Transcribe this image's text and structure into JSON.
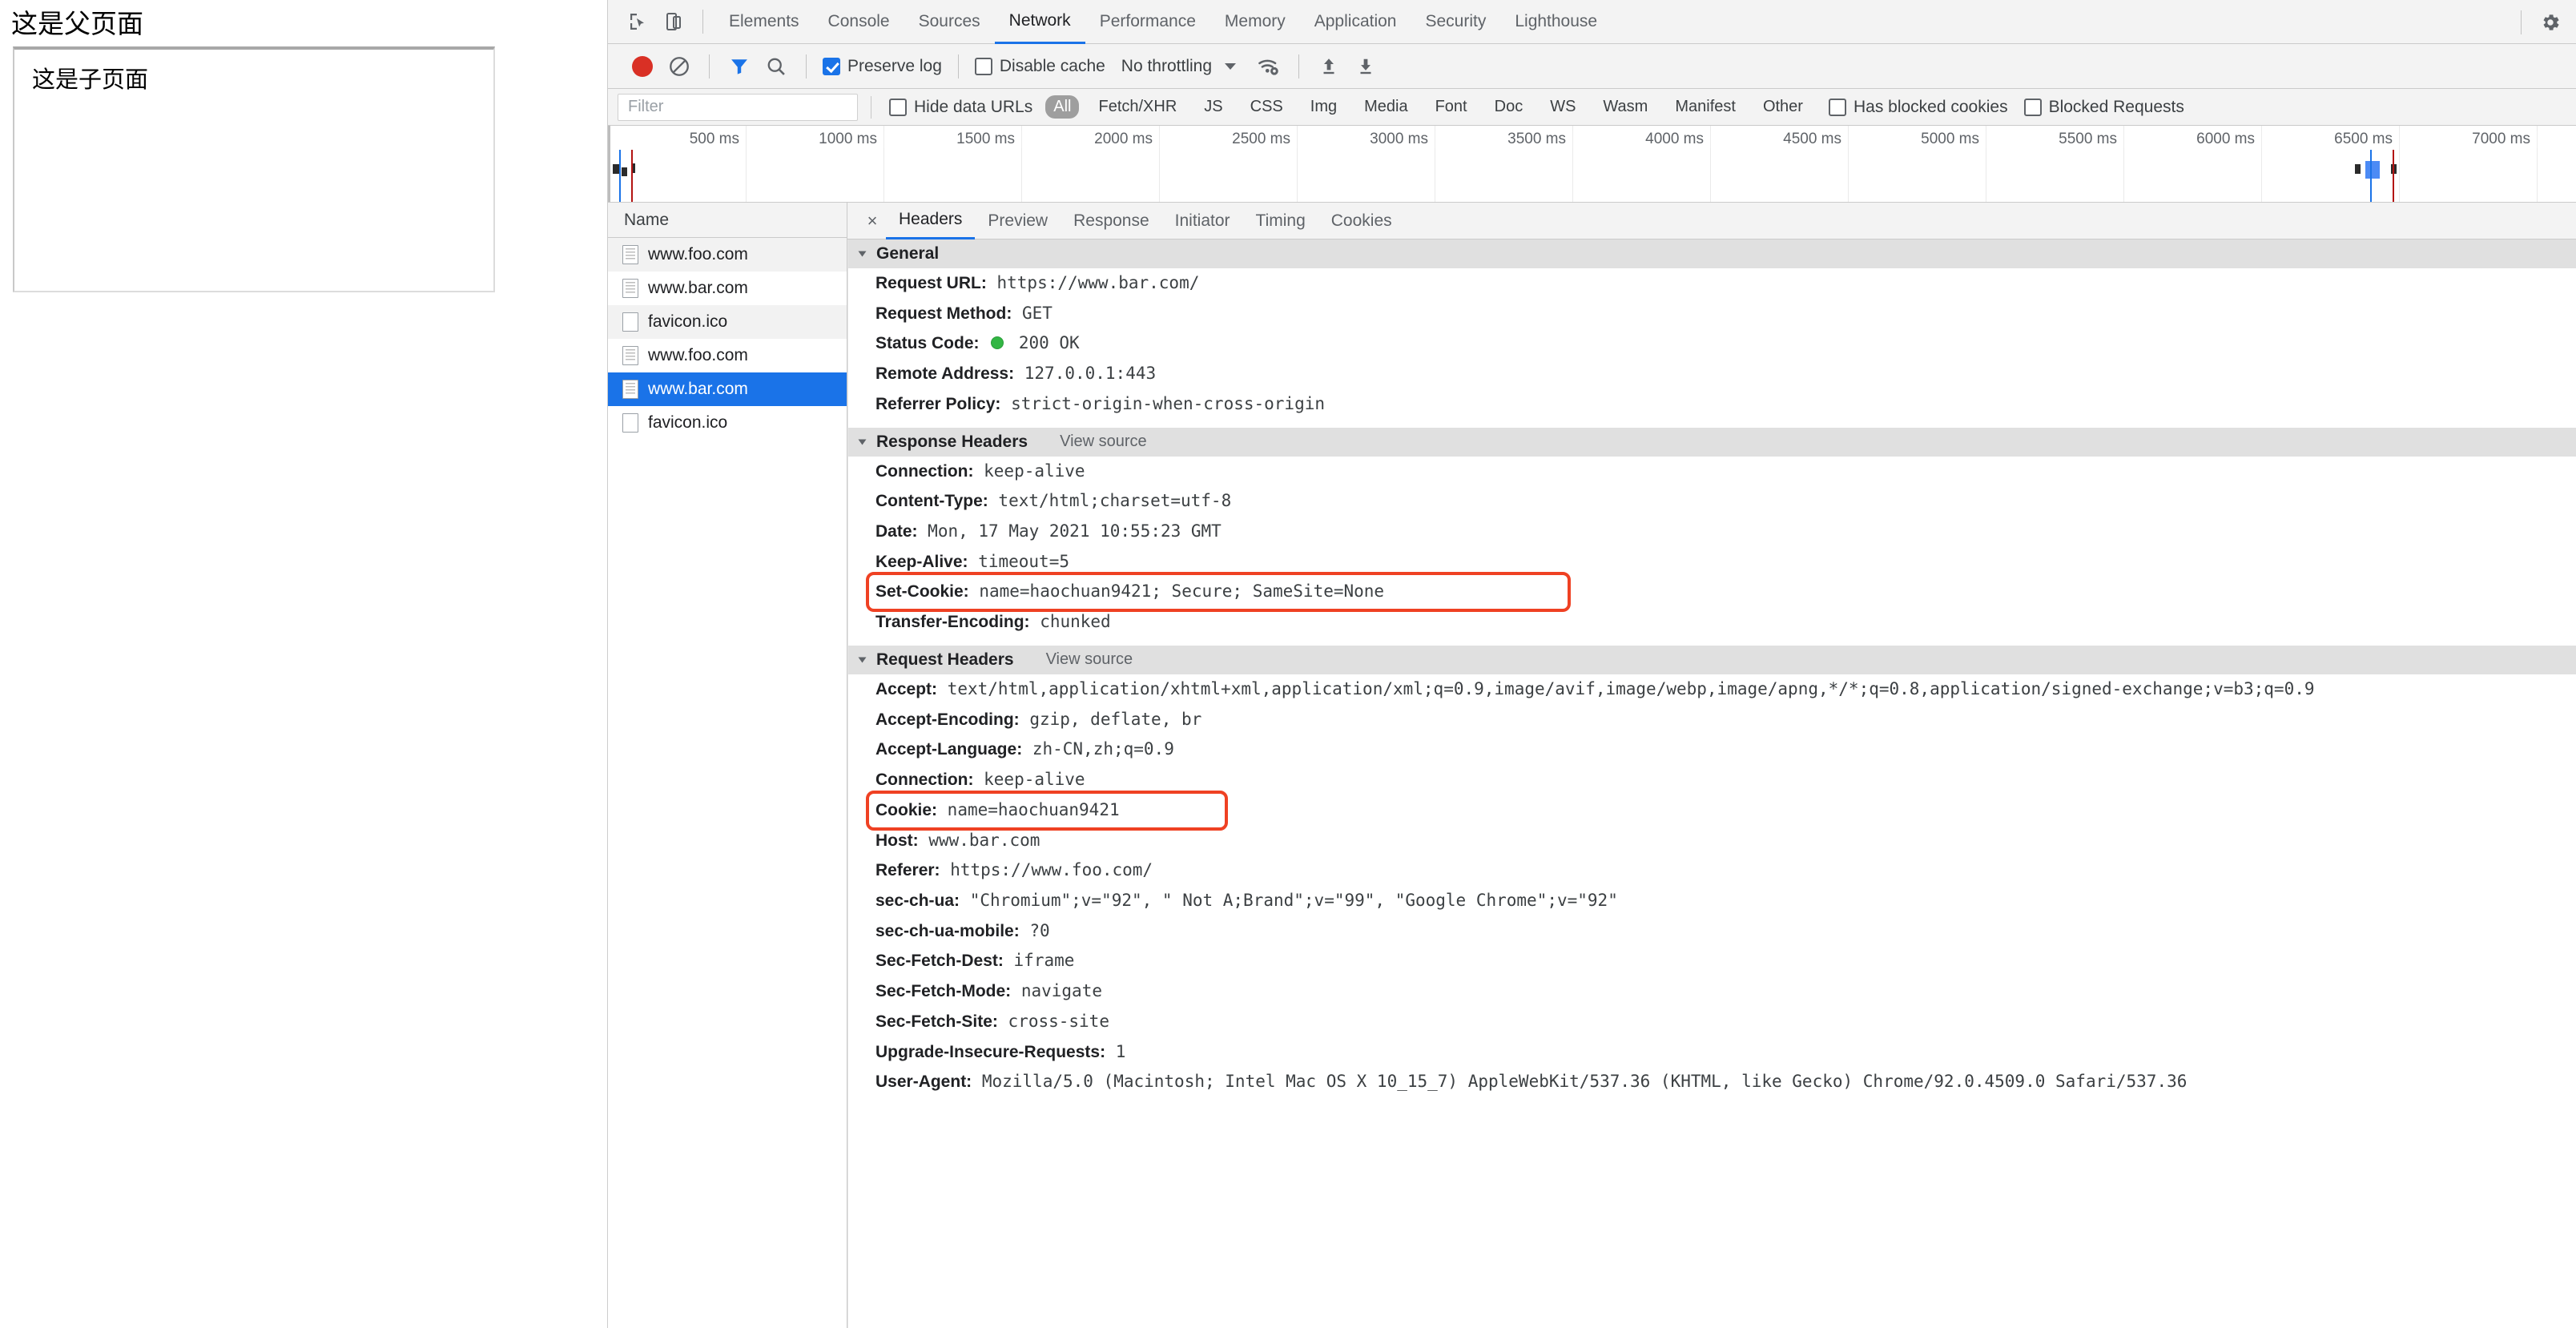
{
  "page": {
    "parent_title": "这是父页面",
    "iframe_title": "这是子页面"
  },
  "devtools": {
    "tabs": [
      {
        "label": "Elements",
        "active": false
      },
      {
        "label": "Console",
        "active": false
      },
      {
        "label": "Sources",
        "active": false
      },
      {
        "label": "Network",
        "active": true
      },
      {
        "label": "Performance",
        "active": false
      },
      {
        "label": "Memory",
        "active": false
      },
      {
        "label": "Application",
        "active": false
      },
      {
        "label": "Security",
        "active": false
      },
      {
        "label": "Lighthouse",
        "active": false
      }
    ],
    "toolbar": {
      "record_icon": "record-circle-icon",
      "clear_icon": "clear-icon",
      "filter_icon": "funnel-icon",
      "search_icon": "search-icon",
      "preserve_log_label": "Preserve log",
      "preserve_log_checked": true,
      "disable_cache_label": "Disable cache",
      "disable_cache_checked": false,
      "throttling_value": "No throttling",
      "wifi_icon": "wifi-settings-icon",
      "import_icon": "import-har-icon",
      "export_icon": "export-har-icon",
      "settings_icon": "gear-icon"
    },
    "filterbar": {
      "filter_placeholder": "Filter",
      "hide_data_urls_label": "Hide data URLs",
      "hide_data_urls_checked": false,
      "types": [
        "All",
        "Fetch/XHR",
        "JS",
        "CSS",
        "Img",
        "Media",
        "Font",
        "Doc",
        "WS",
        "Wasm",
        "Manifest",
        "Other"
      ],
      "selected_type": "All",
      "has_blocked_cookies_label": "Has blocked cookies",
      "has_blocked_cookies_checked": false,
      "blocked_requests_label": "Blocked Requests",
      "blocked_requests_checked": false
    },
    "overview": {
      "tick_labels": [
        "500 ms",
        "1000 ms",
        "1500 ms",
        "2000 ms",
        "2500 ms",
        "3000 ms",
        "3500 ms",
        "4000 ms",
        "4500 ms",
        "5000 ms",
        "5500 ms",
        "6000 ms",
        "6500 ms",
        "7000 ms"
      ],
      "dom_content_loaded_color": "#1a73e8",
      "load_color": "#b31412",
      "selected_bar_color": "#4285f4"
    },
    "requests": {
      "column_header": "Name",
      "rows": [
        {
          "name": "www.foo.com",
          "icon": "document-icon",
          "selected": false
        },
        {
          "name": "www.bar.com",
          "icon": "document-icon",
          "selected": false
        },
        {
          "name": "favicon.ico",
          "icon": "blank-document-icon",
          "selected": false
        },
        {
          "name": "www.foo.com",
          "icon": "document-icon",
          "selected": false
        },
        {
          "name": "www.bar.com",
          "icon": "document-icon",
          "selected": true
        },
        {
          "name": "favicon.ico",
          "icon": "blank-document-icon",
          "selected": false
        }
      ]
    },
    "detail": {
      "close_label": "×",
      "tabs": [
        {
          "label": "Headers",
          "active": true
        },
        {
          "label": "Preview",
          "active": false
        },
        {
          "label": "Response",
          "active": false
        },
        {
          "label": "Initiator",
          "active": false
        },
        {
          "label": "Timing",
          "active": false
        },
        {
          "label": "Cookies",
          "active": false
        }
      ],
      "sections": [
        {
          "title": "General",
          "view_source": "",
          "rows": [
            {
              "key": "Request URL:",
              "value": "https://www.bar.com/",
              "status": false,
              "highlight": false
            },
            {
              "key": "Request Method:",
              "value": "GET",
              "status": false,
              "highlight": false
            },
            {
              "key": "Status Code:",
              "value": "200 OK",
              "status": true,
              "highlight": false
            },
            {
              "key": "Remote Address:",
              "value": "127.0.0.1:443",
              "status": false,
              "highlight": false
            },
            {
              "key": "Referrer Policy:",
              "value": "strict-origin-when-cross-origin",
              "status": false,
              "highlight": false
            }
          ]
        },
        {
          "title": "Response Headers",
          "view_source": "View source",
          "rows": [
            {
              "key": "Connection:",
              "value": "keep-alive",
              "status": false,
              "highlight": false
            },
            {
              "key": "Content-Type:",
              "value": "text/html;charset=utf-8",
              "status": false,
              "highlight": false
            },
            {
              "key": "Date:",
              "value": "Mon, 17 May 2021 10:55:23 GMT",
              "status": false,
              "highlight": false
            },
            {
              "key": "Keep-Alive:",
              "value": "timeout=5",
              "status": false,
              "highlight": false
            },
            {
              "key": "Set-Cookie:",
              "value": "name=haochuan9421; Secure; SameSite=None",
              "status": false,
              "highlight": true
            },
            {
              "key": "Transfer-Encoding:",
              "value": "chunked",
              "status": false,
              "highlight": false
            }
          ]
        },
        {
          "title": "Request Headers",
          "view_source": "View source",
          "rows": [
            {
              "key": "Accept:",
              "value": "text/html,application/xhtml+xml,application/xml;q=0.9,image/avif,image/webp,image/apng,*/*;q=0.8,application/signed-exchange;v=b3;q=0.9",
              "status": false,
              "highlight": false
            },
            {
              "key": "Accept-Encoding:",
              "value": "gzip, deflate, br",
              "status": false,
              "highlight": false
            },
            {
              "key": "Accept-Language:",
              "value": "zh-CN,zh;q=0.9",
              "status": false,
              "highlight": false
            },
            {
              "key": "Connection:",
              "value": "keep-alive",
              "status": false,
              "highlight": false
            },
            {
              "key": "Cookie:",
              "value": "name=haochuan9421",
              "status": false,
              "highlight": true
            },
            {
              "key": "Host:",
              "value": "www.bar.com",
              "status": false,
              "highlight": false
            },
            {
              "key": "Referer:",
              "value": "https://www.foo.com/",
              "status": false,
              "highlight": false
            },
            {
              "key": "sec-ch-ua:",
              "value": "\"Chromium\";v=\"92\", \" Not A;Brand\";v=\"99\", \"Google Chrome\";v=\"92\"",
              "status": false,
              "highlight": false
            },
            {
              "key": "sec-ch-ua-mobile:",
              "value": "?0",
              "status": false,
              "highlight": false
            },
            {
              "key": "Sec-Fetch-Dest:",
              "value": "iframe",
              "status": false,
              "highlight": false
            },
            {
              "key": "Sec-Fetch-Mode:",
              "value": "navigate",
              "status": false,
              "highlight": false
            },
            {
              "key": "Sec-Fetch-Site:",
              "value": "cross-site",
              "status": false,
              "highlight": false
            },
            {
              "key": "Upgrade-Insecure-Requests:",
              "value": "1",
              "status": false,
              "highlight": false
            },
            {
              "key": "User-Agent:",
              "value": "Mozilla/5.0 (Macintosh; Intel Mac OS X 10_15_7) AppleWebKit/537.36 (KHTML, like Gecko) Chrome/92.0.4509.0 Safari/537.36",
              "status": false,
              "highlight": false
            }
          ]
        }
      ]
    },
    "colors": {
      "accent": "#1a73e8",
      "annotation": "#ef4123",
      "status_ok": "#32b643"
    }
  }
}
